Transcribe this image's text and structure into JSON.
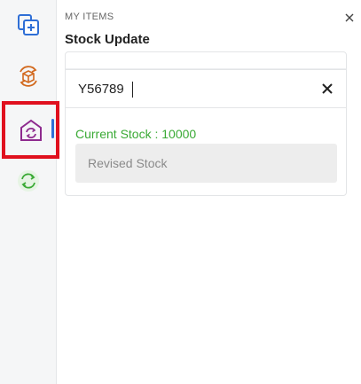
{
  "header": {
    "eyebrow": "MY ITEMS",
    "title": "Stock Update"
  },
  "sidebar": {
    "items": [
      {
        "name": "add-copy",
        "icon": "copy-plus-icon",
        "color": "#2f6fd6"
      },
      {
        "name": "box-sync",
        "icon": "box-refresh-icon",
        "color": "#d2691e"
      },
      {
        "name": "warehouse-sync",
        "icon": "warehouse-refresh-icon",
        "color": "#8e2b8e",
        "active": true
      },
      {
        "name": "refresh",
        "icon": "refresh-icon",
        "color": "#3aaa35"
      }
    ],
    "active_color": "#2f6fd6",
    "highlight_color": "#e0101e"
  },
  "search": {
    "value": "Y56789"
  },
  "stock": {
    "current_label": "Current Stock : 10000",
    "revised_placeholder": "Revised Stock"
  },
  "colors": {
    "accent_green": "#3aaa35"
  }
}
